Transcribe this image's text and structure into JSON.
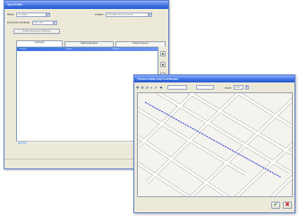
{
  "back_window": {
    "title": "Spot Profile",
    "row1": {
      "label": "Market",
      "value": "Z in Market",
      "label2": "Location",
      "value2": "1201 Halifax Street & Jones Rd"
    },
    "row2": {
      "label": "Zoning Set Coordinate",
      "value": "1234 - 5678"
    },
    "address_button": "Thomas Guide map Coordinates",
    "tabs": [
      "Landmarks",
      "Traffic & Directions",
      "Points of Interest"
    ],
    "list_headers": [
      "Landmark",
      "Distance",
      "Direction"
    ]
  },
  "front_window": {
    "title": "Thomas Guide map Coordinates",
    "toolbar": {
      "zoom_label": "Zoom",
      "zoom_value": "100%",
      "field1": "",
      "field2": ""
    },
    "ok_icon": "checkmark-icon",
    "cancel_icon": "x-icon"
  },
  "colors": {
    "titlebar": "#3b6fe0",
    "window_face": "#ece9d8",
    "route_line": "#2b3fd6",
    "map_road": "#ffffff",
    "map_bg": "#f4f3ee"
  }
}
